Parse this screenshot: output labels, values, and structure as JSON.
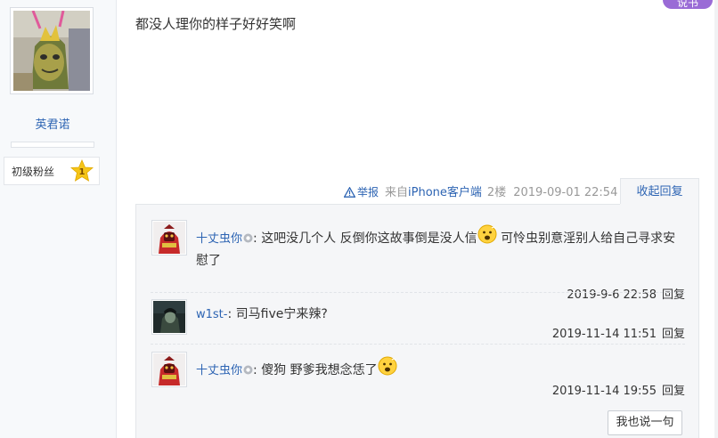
{
  "user": {
    "name": "英君诺",
    "badge_label": "初级粉丝",
    "badge_level": "1"
  },
  "post": {
    "content": "都没人理你的样子好好笑啊",
    "report_label": "举报",
    "source_prefix": "来自",
    "source_app": "iPhone客户端",
    "floor": "2楼",
    "time": "2019-09-01 22:54",
    "collapse_label": "收起回复"
  },
  "corner_tag": "说书",
  "replies": [
    {
      "author": "十丈虫你",
      "text_a": "这吧没几个人 反倒你这故事倒是没人信",
      "text_b": " 可怜虫别意淫别人给自己寻求安慰了",
      "time": "2019-9-6 22:58",
      "reply_label": "回复"
    },
    {
      "author": "w1st-",
      "text_a": "司马five宁来辣?",
      "time": "2019-11-14 11:51",
      "reply_label": "回复"
    },
    {
      "author": "十丈虫你",
      "text_a": "傻狗 野爹我想念恁了",
      "time": "2019-11-14 19:55",
      "reply_label": "回复"
    }
  ],
  "say_button": "我也说一句",
  "colors": {
    "link": "#2d64b3",
    "panel": "#f5f6f8",
    "badge_star": "#f5c518"
  },
  "icons": [
    "warning-icon",
    "vip-icon",
    "emoji-icon",
    "star-badge-icon"
  ]
}
